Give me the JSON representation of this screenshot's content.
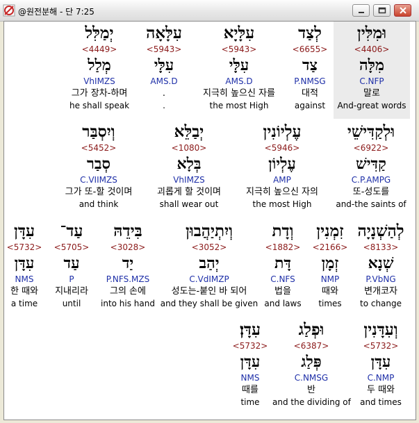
{
  "window": {
    "title": "@원전분해 - 단 7:25"
  },
  "rows": [
    {
      "words": [
        {
          "hebrew": "וּמִלִּין",
          "strong": "<4406>",
          "lemma": "מִלָּה",
          "morph": "C.NFP",
          "korean": "말로",
          "english": "And-great words"
        },
        {
          "hebrew": "לְצַד",
          "strong": "<6655>",
          "lemma": "צַד",
          "morph": "P.NMSG",
          "korean": "대적",
          "english": "against"
        },
        {
          "hebrew": "עִלָּיָא",
          "strong": "<5943>",
          "lemma": "עִלָּי",
          "morph": "AMS.D",
          "korean": "지극히 높으신 자를",
          "english": "the most High"
        },
        {
          "hebrew": "עִלָּאָה",
          "strong": "<5943>",
          "lemma": "עִלָּי",
          "morph": "AMS.D",
          "korean": ".",
          "english": "."
        },
        {
          "hebrew": "יְמַלִּל",
          "strong": "<4449>",
          "lemma": "מְלַל",
          "morph": "VhIMZS",
          "korean": "그가 장차-하며",
          "english": "he shall speak"
        }
      ]
    },
    {
      "words": [
        {
          "hebrew": "וּלְקַדִּישֵׁי",
          "strong": "<6922>",
          "lemma": "קַדִּישׁ",
          "morph": "C.P.AMPG",
          "korean": "또-성도를",
          "english": "and-the saints of"
        },
        {
          "hebrew": "עֶלְיוֹנִין",
          "strong": "<5946>",
          "lemma": "עֶלְיוֹן",
          "morph": "AMP",
          "korean": "지극히 높으신 자의",
          "english": "the most High"
        },
        {
          "hebrew": "יְבַלֵּא",
          "strong": "<1080>",
          "lemma": "בְּלָא",
          "morph": "VhIMZS",
          "korean": "괴롭게 할 것이며",
          "english": "shall wear out"
        },
        {
          "hebrew": "וְיִסְבַּר",
          "strong": "<5452>",
          "lemma": "סְבַר",
          "morph": "C.VIIMZS",
          "korean": "그가 또-할 것이며",
          "english": "and think"
        }
      ]
    },
    {
      "words": [
        {
          "hebrew": "לְהַשְׁנָיָה",
          "strong": "<8133>",
          "lemma": "שְׁנָא",
          "morph": "P.VbNG",
          "korean": "변개코자",
          "english": "to change"
        },
        {
          "hebrew": "זִמְנִין",
          "strong": "<2166>",
          "lemma": "זְמָן",
          "morph": "NMP",
          "korean": "때와",
          "english": "times"
        },
        {
          "hebrew": "וְדָת",
          "strong": "<1882>",
          "lemma": "דָּת",
          "morph": "C.NFS",
          "korean": "법을",
          "english": "and laws"
        },
        {
          "hebrew": "וְיִתְיַהֲבוּן",
          "strong": "<3052>",
          "lemma": "יְהַב",
          "morph": "C.VdIMZP",
          "korean": "성도는-붙인 바 되어",
          "english": "and they shall be given"
        },
        {
          "hebrew": "בִּידֵהּ",
          "strong": "<3028>",
          "lemma": "יַד",
          "morph": "P.NFS.MZS",
          "korean": "그의 손에",
          "english": "into his hand"
        },
        {
          "hebrew": "עַד־",
          "strong": "<5705>",
          "lemma": "עַד",
          "morph": "P",
          "korean": "지내리라",
          "english": "until"
        },
        {
          "hebrew": "עִדָּן",
          "strong": "<5732>",
          "lemma": "עִדָּן",
          "morph": "NMS",
          "korean": "한 때와",
          "english": "a time"
        }
      ]
    },
    {
      "words": [
        {
          "hebrew": "וְעִדָּנִין",
          "strong": "<5732>",
          "lemma": "עִדָּן",
          "morph": "C.NMP",
          "korean": "두 때와",
          "english": "and times"
        },
        {
          "hebrew": "וּפְלַג",
          "strong": "<6387>",
          "lemma": "פְּלַג",
          "morph": "C.NMSG",
          "korean": "반",
          "english": "and the dividing of"
        },
        {
          "hebrew": "עִדָּן׃",
          "strong": "<5732>",
          "lemma": "עִדָּן",
          "morph": "NMS",
          "korean": "때를",
          "english": "time"
        }
      ]
    }
  ]
}
